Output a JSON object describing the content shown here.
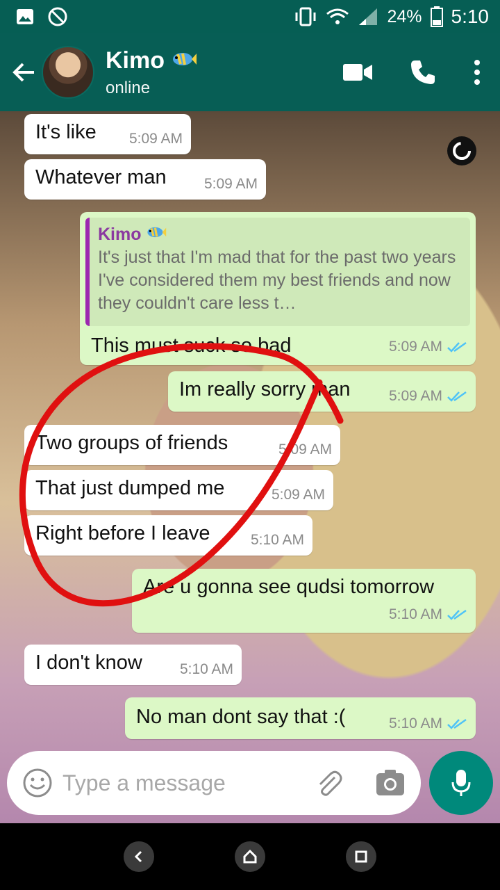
{
  "statusbar": {
    "battery": "24%",
    "time": "5:10"
  },
  "header": {
    "name": "Kimo",
    "status": "online"
  },
  "messages": [
    {
      "dir": "in",
      "text": "It's like",
      "time": "5:09 AM"
    },
    {
      "dir": "in",
      "text": "Whatever man",
      "time": "5:09 AM"
    },
    {
      "dir": "out",
      "quote_name": "Kimo",
      "quote_text": "It's just that I'm mad that for the past two years I've considered them my best friends and now they couldn't care less t…",
      "text": "This must suck so bad",
      "time": "5:09 AM"
    },
    {
      "dir": "out",
      "text": "Im really sorry man",
      "time": "5:09 AM"
    },
    {
      "dir": "in",
      "text": "Two groups of friends",
      "time": "5:09 AM"
    },
    {
      "dir": "in",
      "text": "That just dumped me",
      "time": "5:09 AM"
    },
    {
      "dir": "in",
      "text": "Right before I leave",
      "time": "5:10 AM"
    },
    {
      "dir": "out",
      "text": "Are u gonna see qudsi tomorrow",
      "time": "5:10 AM"
    },
    {
      "dir": "in",
      "text": "I don't know",
      "time": "5:10 AM"
    },
    {
      "dir": "out",
      "text": "No man dont say that :(",
      "time": "5:10 AM"
    }
  ],
  "input": {
    "placeholder": "Type a message"
  },
  "colors": {
    "header": "#075e55",
    "outgoing": "#dcf8c6",
    "incoming": "#ffffff",
    "annotation": "#e01010",
    "ticks": "#4fc3f7"
  }
}
